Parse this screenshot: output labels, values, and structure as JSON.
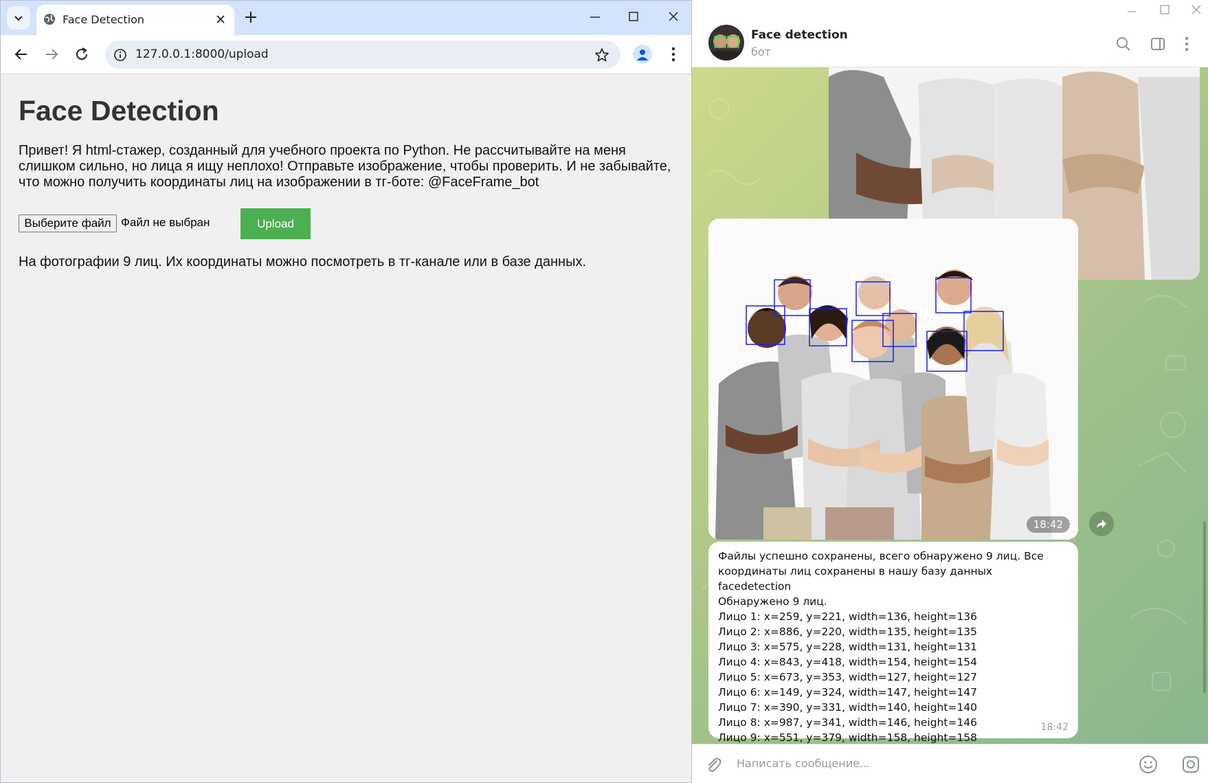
{
  "browser": {
    "tab_title": "Face Detection",
    "url": "127.0.0.1:8000/upload"
  },
  "webpage": {
    "title": "Face Detection",
    "intro": "Привет! Я html-стажер, созданный для учебного проекта по Python. Не рассчитывайте на меня слишком сильно, но лица я ищу неплохо! Отправьте изображение, чтобы проверить. И не забывайте, что можно получить координаты лиц на изображении в тг-боте: @FaceFrame_bot",
    "file_button_label": "Выберите файл",
    "file_status": "Файл не выбран",
    "upload_label": "Upload",
    "result": "На фотографии 9 лиц. Их координаты можно посмотреть в тг-канале или в базе данных."
  },
  "telegram": {
    "chat_name": "Face detection",
    "chat_status": "бот",
    "photo_time": "18:42",
    "message_lines": [
      "Файлы успешно сохранены, всего обнаружено 9 лиц. Все",
      "координаты лиц сохранены в нашу базу данных facedetection",
      "Обнаружено 9 лиц.",
      "Лицо 1: x=259, y=221, width=136, height=136",
      "Лицо 2: x=886, y=220, width=135, height=135",
      "Лицо 3: x=575, y=228, width=131, height=131",
      "Лицо 4: x=843, y=418, width=154, height=154",
      "Лицо 5: x=673, y=353, width=127, height=127",
      "Лицо 6: x=149, y=324, width=147, height=147",
      "Лицо 7: x=390, y=331, width=140, height=140",
      "Лицо 8: x=987, y=341, width=146, height=146",
      "Лицо 9: x=551, y=379, width=158, height=158"
    ],
    "message_time": "18:42",
    "input_placeholder": "Написать сообщение..."
  }
}
